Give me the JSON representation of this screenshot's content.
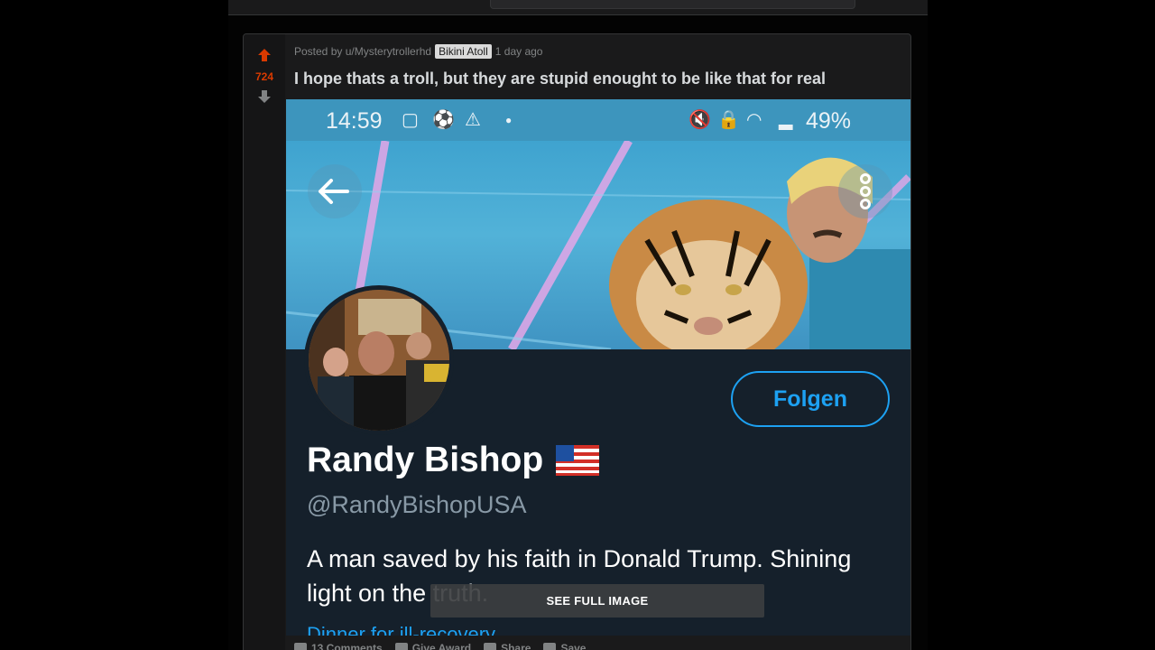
{
  "post": {
    "vote_count": "724",
    "posted_by": "Posted by u/Mysterytrollerhd",
    "flair": "Bikini Atoll",
    "age": "1 day ago",
    "title": "I hope thats a troll, but they are stupid enought to be like that for real",
    "actions": {
      "comments": "13 Comments",
      "award": "Give Award",
      "share": "Share",
      "save": "Save"
    },
    "see_full_image": "SEE FULL IMAGE"
  },
  "screenshot": {
    "status_time": "14:59",
    "battery": "49%",
    "follow_label": "Folgen",
    "display_name": "Randy Bishop",
    "handle": "@RandyBishopUSA",
    "bio": "A man saved by his faith in Donald Trump.  Shining light on the truth.",
    "bio_link": "Dinner for ill-recovery"
  },
  "colors": {
    "upvote": "#d93a00",
    "twitter_blue": "#1da1f2",
    "twitter_bg": "#15202b"
  }
}
